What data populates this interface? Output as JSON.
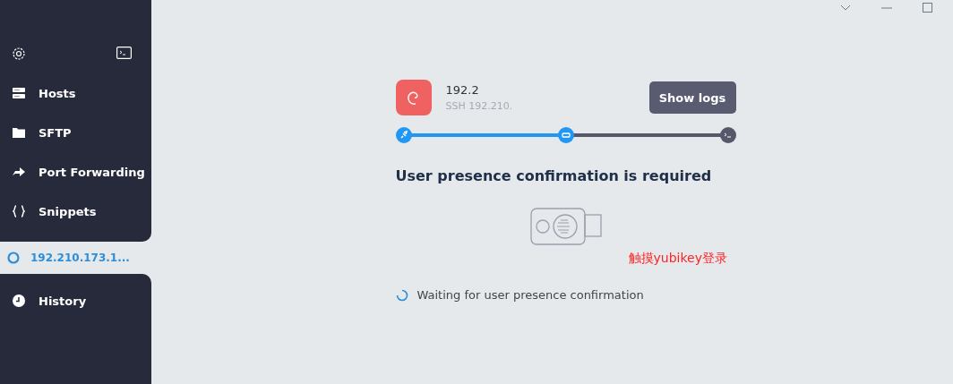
{
  "sidebar": {
    "items": [
      {
        "label": "Hosts",
        "kind": "hosts",
        "selected": false
      },
      {
        "label": "SFTP",
        "kind": "folder",
        "selected": false
      },
      {
        "label": "Port Forwarding",
        "kind": "forward",
        "selected": false
      },
      {
        "label": "Snippets",
        "kind": "braces",
        "selected": false
      }
    ],
    "session": {
      "label": "192.210.173.1...",
      "selected": true
    },
    "history": {
      "label": "History",
      "selected": false
    }
  },
  "host": {
    "name": "192.2",
    "subtitle": "SSH 192.210."
  },
  "show_logs": "Show logs",
  "progress": {
    "level": 0.5,
    "steps": [
      {
        "kind": "plug",
        "active": true
      },
      {
        "kind": "key",
        "active": true
      },
      {
        "kind": "terminal",
        "active": false
      }
    ]
  },
  "heading": "User presence confirmation is required",
  "annotation": "触摸yubikey登录",
  "status": "Waiting for user presence confirmation"
}
